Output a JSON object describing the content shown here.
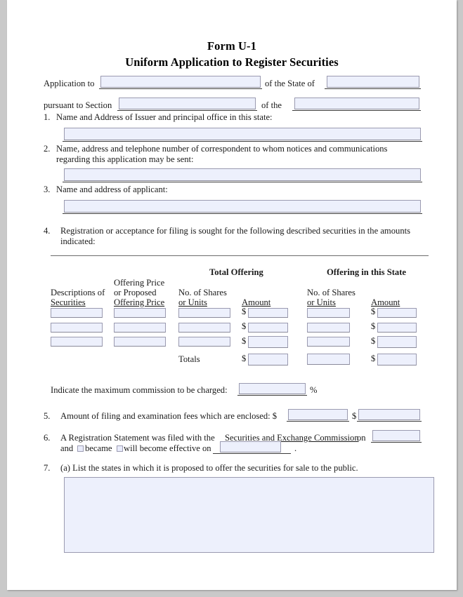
{
  "document": {
    "title_line1": "Form U-1",
    "title_line2": "Uniform Application to Register Securities"
  },
  "header_line": {
    "label_application_to": "Application to",
    "label_of_the_state_of": "of the State of",
    "label_pursuant_to_section": "pursuant to Section",
    "label_of_the": "of the",
    "value_application_to": "",
    "value_state": "",
    "value_section": "",
    "value_of_the": ""
  },
  "items": [
    {
      "number": "1.",
      "text": "Name and Address of Issuer and principal office in this state:",
      "value": ""
    },
    {
      "number": "2.",
      "text_line1": "Name, address and telephone number of correspondent to whom notices and communications",
      "text_line2": "regarding this application may be sent:",
      "value": ""
    },
    {
      "number": "3.",
      "text": "Name and address of applicant:",
      "value": ""
    },
    {
      "number": "4.",
      "text_line1": "Registration or acceptance for filing is sought for the following described securities in the amounts",
      "text_line2": "indicated:"
    }
  ],
  "securities_table": {
    "group_headers": [
      {
        "label": "Total Offering"
      },
      {
        "label": "Offering in this State"
      }
    ],
    "columns": [
      {
        "line1": "Descriptions of",
        "line2": "Securities"
      },
      {
        "line1": "Offering Price",
        "line2": "or Proposed",
        "line3": "Offering Price"
      },
      {
        "line1": "No. of Shares",
        "line2": "or Units"
      },
      {
        "line1": "Amount",
        "prefix": "$"
      },
      {
        "line1": "No. of Shares",
        "line2": "or Units"
      },
      {
        "line1": "Amount",
        "prefix": "$"
      }
    ],
    "totals_label": "Totals",
    "rows": [
      {
        "description": "",
        "offering_price": "",
        "total_shares": "",
        "total_amount": "",
        "state_shares": "",
        "state_amount": ""
      },
      {
        "description": "",
        "offering_price": "",
        "total_shares": "",
        "total_amount": "",
        "state_shares": "",
        "state_amount": ""
      },
      {
        "description": "",
        "offering_price": "",
        "total_shares": "",
        "total_amount": "",
        "state_shares": "",
        "state_amount": ""
      }
    ],
    "totals_row": {
      "total_amount": "",
      "state_shares": "",
      "state_amount": ""
    }
  },
  "commission": {
    "label": "Indicate the maximum commission to be charged:",
    "value": "",
    "suffix": "%"
  },
  "item5": {
    "number": "5.",
    "text": "Amount of filing and examination fees which are enclosed: $",
    "value_1": "",
    "dollar_2": "$",
    "value_2": ""
  },
  "item6": {
    "number": "6.",
    "text_before": "A Registration Statement was filed with the ",
    "text_underlined": "Securities and Exchange Commission",
    "text_after": " on",
    "date_filed": "",
    "and_label": "and",
    "checkbox_became_label": "became",
    "checkbox_will_become_label": "will become effective on",
    "checkbox_became_checked": false,
    "checkbox_will_become_checked": false,
    "effective_date": "",
    "period": "."
  },
  "item7": {
    "number": "7.",
    "text": "(a) List the states in which it is proposed to offer the securities for sale to the public.",
    "value": ""
  }
}
